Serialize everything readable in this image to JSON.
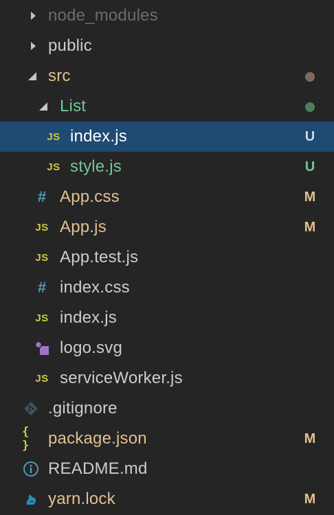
{
  "explorer": {
    "items": [
      {
        "label": "node_modules",
        "type": "folder-collapsed"
      },
      {
        "label": "public",
        "type": "folder-collapsed"
      },
      {
        "label": "src",
        "type": "folder-expanded",
        "status_dot_color": "#7e6a5c"
      },
      {
        "label": "List",
        "type": "folder-expanded",
        "status_dot_color": "#4e7d5a"
      },
      {
        "label": "index.js",
        "type": "js",
        "icon_text": "JS",
        "badge": "U",
        "selected": true
      },
      {
        "label": "style.js",
        "type": "js",
        "icon_text": "JS",
        "badge": "U"
      },
      {
        "label": "App.css",
        "type": "css",
        "icon_text": "#",
        "badge": "M"
      },
      {
        "label": "App.js",
        "type": "js",
        "icon_text": "JS",
        "badge": "M"
      },
      {
        "label": "App.test.js",
        "type": "js",
        "icon_text": "JS"
      },
      {
        "label": "index.css",
        "type": "css",
        "icon_text": "#"
      },
      {
        "label": "index.js",
        "type": "js",
        "icon_text": "JS"
      },
      {
        "label": "logo.svg",
        "type": "svg"
      },
      {
        "label": "serviceWorker.js",
        "type": "js",
        "icon_text": "JS"
      },
      {
        "label": ".gitignore",
        "type": "git"
      },
      {
        "label": "package.json",
        "type": "json",
        "icon_text": "{ }",
        "badge": "M"
      },
      {
        "label": "README.md",
        "type": "info"
      },
      {
        "label": "yarn.lock",
        "type": "yarn",
        "badge": "M"
      }
    ]
  },
  "colors": {
    "background": "#252526",
    "selection": "#1e4a74",
    "modified": "#e2c08d",
    "untracked": "#73c991",
    "ignored": "#6c6c6c",
    "js_icon": "#cbcb41",
    "css_icon": "#519aba",
    "svg_icon": "#a074c4",
    "yarn_icon": "#2c8ebb"
  }
}
